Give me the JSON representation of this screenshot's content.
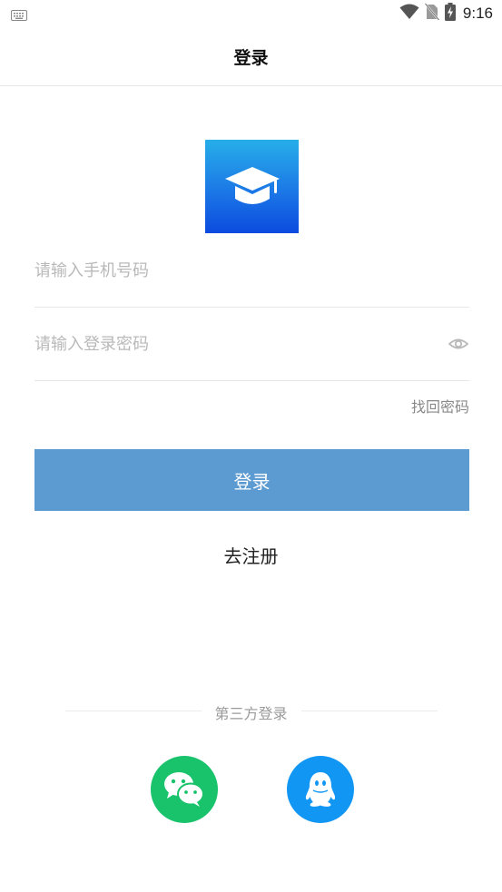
{
  "status_bar": {
    "time": "9:16"
  },
  "header": {
    "title": "登录"
  },
  "login_form": {
    "phone_placeholder": "请输入手机号码",
    "password_placeholder": "请输入登录密码",
    "forgot_password": "找回密码",
    "login_button": "登录",
    "register_link": "去注册"
  },
  "third_party": {
    "label": "第三方登录",
    "providers": [
      "wechat-icon",
      "qq-icon"
    ]
  },
  "colors": {
    "login_button": "#5c9bd1",
    "wechat": "#18c36b",
    "qq": "#1296f4",
    "logo_gradient_top": "#27aee9",
    "logo_gradient_bottom": "#0b4bdf"
  }
}
